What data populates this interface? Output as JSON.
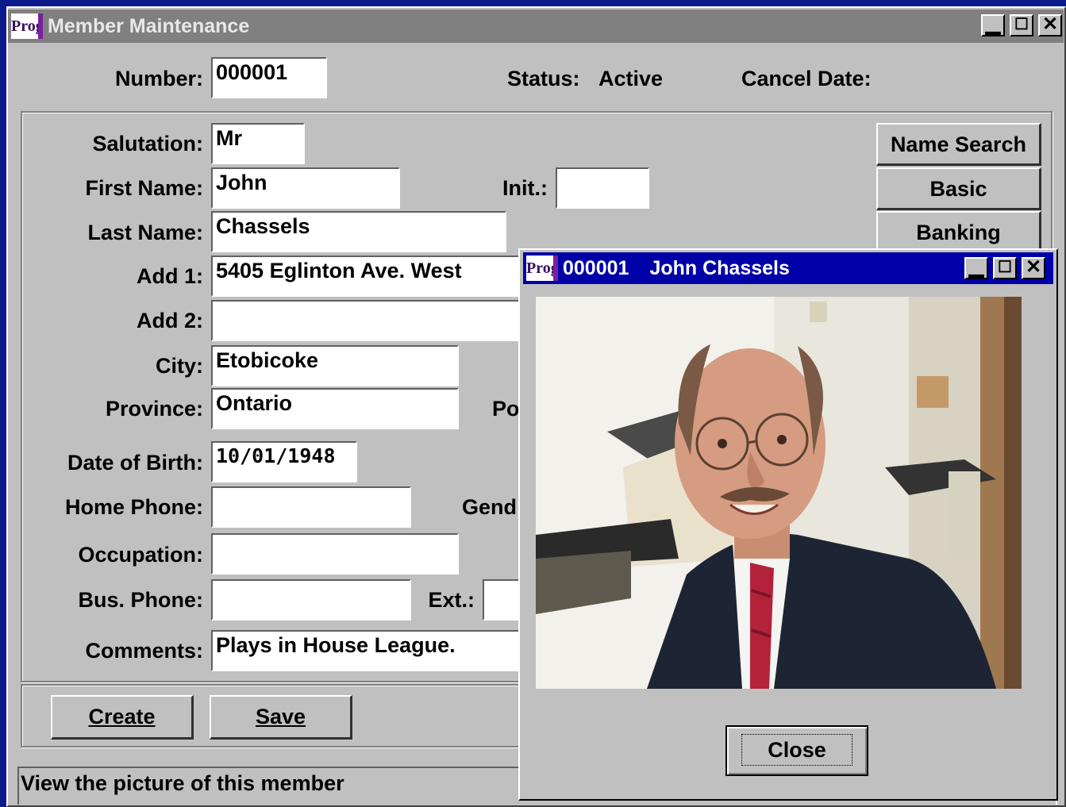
{
  "main_window": {
    "title": "Member Maintenance",
    "icon_text": "Prog",
    "number_label": "Number:",
    "number_value": "000001",
    "status_label": "Status:",
    "status_value": "Active",
    "cancel_date_label": "Cancel Date:",
    "fields": {
      "salutation": {
        "label": "Salutation:",
        "value": "Mr"
      },
      "first_name": {
        "label": "First Name:",
        "value": "John"
      },
      "init": {
        "label": "Init.:",
        "value": ""
      },
      "last_name": {
        "label": "Last Name:",
        "value": "Chassels"
      },
      "add1": {
        "label": "Add 1:",
        "value": "5405 Eglinton Ave. West"
      },
      "add2": {
        "label": "Add 2:",
        "value": ""
      },
      "city": {
        "label": "City:",
        "value": "Etobicoke"
      },
      "province": {
        "label": "Province:",
        "value": "Ontario"
      },
      "postal_partial": "Po",
      "dob": {
        "label": "Date of Birth:",
        "value": "10/01/1948"
      },
      "home_phone": {
        "label": "Home Phone:",
        "value": ""
      },
      "gender_partial": "Gend",
      "occupation": {
        "label": "Occupation:",
        "value": ""
      },
      "bus_phone": {
        "label": "Bus. Phone:",
        "value": ""
      },
      "ext": {
        "label": "Ext.:",
        "value": ""
      },
      "comments": {
        "label": "Comments:",
        "value": "Plays in House League."
      }
    },
    "side_buttons": [
      "Name Search",
      "Basic",
      "Banking"
    ],
    "create_label": "Create",
    "save_label": "Save",
    "status_bar": "View the picture of this member"
  },
  "photo_window": {
    "title_number": "000001",
    "title_name": "John Chassels",
    "icon_text": "Prog",
    "close_label": "Close"
  },
  "colors": {
    "desktop": "#0b1a8a",
    "active_title": "#0000a8",
    "inactive_title": "#808080",
    "face": "#c0c0c0"
  }
}
